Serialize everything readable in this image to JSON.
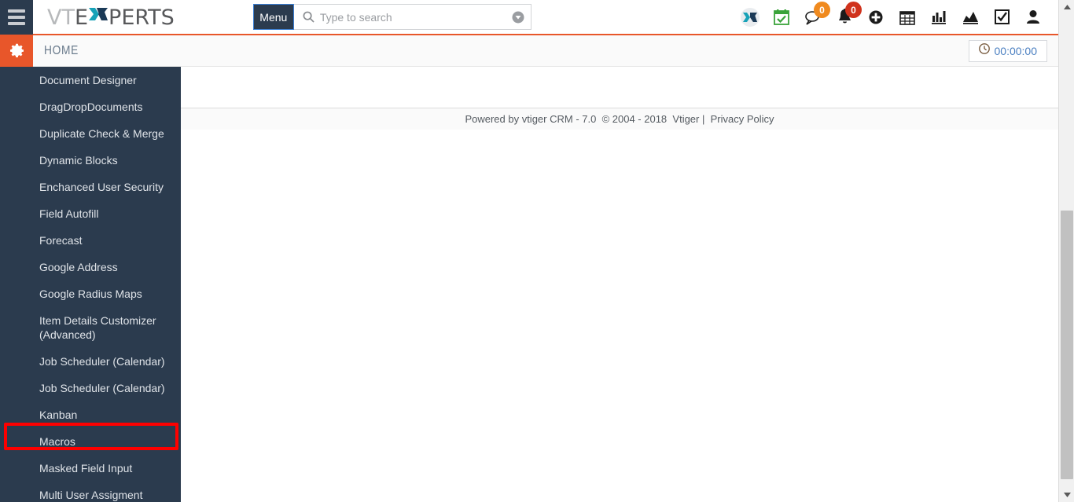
{
  "app": {
    "brand": {
      "part1": "VT",
      "part2": "E",
      "part3": "X",
      "part4": "PERTS"
    }
  },
  "topbar": {
    "hamburger_icon": "hamburger-icon",
    "menu_label": "Menu",
    "search": {
      "placeholder": "Type to search",
      "value": "",
      "icon": "search-icon",
      "chevron_icon": "chevron-down-circle-icon"
    },
    "icons": [
      {
        "name": "xpert-logo-icon",
        "glyph": "X",
        "badge": null,
        "badge_color": null
      },
      {
        "name": "calendar-check-icon",
        "glyph": "",
        "badge": null,
        "badge_color": null
      },
      {
        "name": "chat-bubble-icon",
        "glyph": "",
        "badge": "0",
        "badge_color": "#f08a1e"
      },
      {
        "name": "bell-notification-icon",
        "glyph": "",
        "badge": "0",
        "badge_color": "#d0321c"
      },
      {
        "name": "quick-create-plus-icon",
        "glyph": "",
        "badge": null,
        "badge_color": null
      },
      {
        "name": "calendar-grid-icon",
        "glyph": "",
        "badge": null,
        "badge_color": null
      },
      {
        "name": "bar-chart-icon",
        "glyph": "",
        "badge": null,
        "badge_color": null
      },
      {
        "name": "area-chart-icon",
        "glyph": "",
        "badge": null,
        "badge_color": null
      },
      {
        "name": "checkbox-tasks-icon",
        "glyph": "",
        "badge": null,
        "badge_color": null
      },
      {
        "name": "user-profile-icon",
        "glyph": "",
        "badge": null,
        "badge_color": null
      }
    ]
  },
  "breadcrumb": {
    "gear_icon": "gear-icon",
    "title": "HOME",
    "timer": {
      "icon": "clock-icon",
      "value": "00:00:00"
    }
  },
  "sidebar": {
    "items": [
      {
        "label": "Document Designer",
        "multiline": false
      },
      {
        "label": "DragDropDocuments",
        "multiline": false
      },
      {
        "label": "Duplicate Check & Merge",
        "multiline": false
      },
      {
        "label": "Dynamic Blocks",
        "multiline": false
      },
      {
        "label": "Enchanced User Security",
        "multiline": false
      },
      {
        "label": "Field Autofill",
        "multiline": false
      },
      {
        "label": "Forecast",
        "multiline": false
      },
      {
        "label": "Google Address",
        "multiline": false
      },
      {
        "label": "Google Radius Maps",
        "multiline": false
      },
      {
        "label": "Item Details Customizer (Advanced)",
        "multiline": true
      },
      {
        "label": "Job Scheduler (Calendar)",
        "multiline": false
      },
      {
        "label": "Job Scheduler (Calendar)",
        "multiline": false
      },
      {
        "label": "Kanban",
        "multiline": false
      },
      {
        "label": "Macros",
        "multiline": false,
        "highlighted": true
      },
      {
        "label": "Masked Field Input",
        "multiline": false
      },
      {
        "label": "Multi User Assigment",
        "multiline": false
      }
    ]
  },
  "footer": {
    "powered_by": "Powered by vtiger CRM - 7.0",
    "copyright": "© 2004 - 2018",
    "company": "Vtiger",
    "separator": "|",
    "privacy_link": "Privacy Policy"
  },
  "scrollbar": {
    "up_arrow": "scroll-up-arrow-icon",
    "down_arrow": "scroll-down-arrow-icon"
  },
  "colors": {
    "accent_orange": "#e8562a",
    "dark_navy": "#2b3b4e",
    "highlight_red": "#ff0000",
    "timer_blue": "#4a7fc1"
  }
}
